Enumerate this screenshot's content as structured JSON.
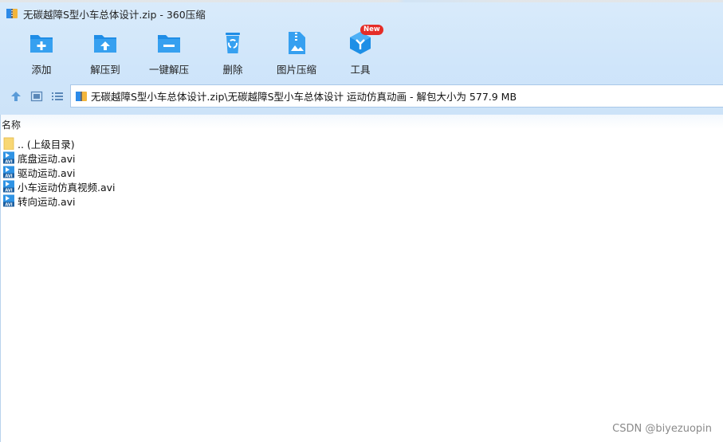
{
  "window": {
    "title": "无碳越障S型小车总体设计.zip - 360压缩",
    "app_icon": "360zip-app-icon"
  },
  "toolbar": {
    "items": [
      {
        "label": "添加",
        "icon": "add-folder-icon"
      },
      {
        "label": "解压到",
        "icon": "extract-to-icon"
      },
      {
        "label": "一键解压",
        "icon": "one-click-extract-icon"
      },
      {
        "label": "删除",
        "icon": "recycle-bin-icon"
      },
      {
        "label": "图片压缩",
        "icon": "image-compress-icon"
      },
      {
        "label": "工具",
        "icon": "tools-cube-icon",
        "badge": "New"
      }
    ]
  },
  "nav": {
    "buttons": [
      "up-arrow-icon",
      "view-thumbnail-icon",
      "view-list-icon"
    ]
  },
  "address": {
    "path": "无碳越障S型小车总体设计.zip\\无碳越障S型小车总体设计 运动仿真动画 - 解包大小为 577.9 MB"
  },
  "list": {
    "column_name": "名称",
    "files": [
      {
        "name": ".. (上级目录)",
        "type": "parent-folder"
      },
      {
        "name": "底盘运动.avi",
        "type": "avi"
      },
      {
        "name": "驱动运动.avi",
        "type": "avi"
      },
      {
        "name": "小车运动仿真视频.avi",
        "type": "avi"
      },
      {
        "name": "转向运动.avi",
        "type": "avi"
      }
    ]
  },
  "watermark": "CSDN @biyezuopin",
  "colors": {
    "chrome_bg": "#d4e8fb",
    "accent_blue": "#1e8fe6",
    "badge_red": "#e52d27"
  }
}
